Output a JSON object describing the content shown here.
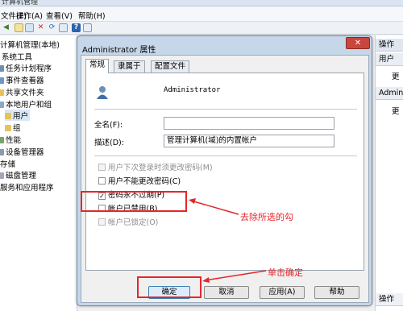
{
  "titlebar": {
    "text": "计算机管理"
  },
  "menubar": {
    "items": [
      "文件(F)",
      "操作(A)",
      "查看(V)",
      "帮助(H)"
    ]
  },
  "tree": {
    "items": [
      {
        "label": "计算机管理(本地)",
        "level": 0
      },
      {
        "label": "系统工具",
        "level": 1
      },
      {
        "label": "任务计划程序",
        "level": 2
      },
      {
        "label": "事件查看器",
        "level": 2
      },
      {
        "label": "共享文件夹",
        "level": 2
      },
      {
        "label": "本地用户和组",
        "level": 2
      },
      {
        "label": "用户",
        "level": 3
      },
      {
        "label": "组",
        "level": 3
      },
      {
        "label": "性能",
        "level": 2
      },
      {
        "label": "设备管理器",
        "level": 2
      },
      {
        "label": "存储",
        "level": 1
      },
      {
        "label": "磁盘管理",
        "level": 2
      },
      {
        "label": "服务和应用程序",
        "level": 1
      }
    ]
  },
  "actions": {
    "header1": "操作",
    "section1": "用户",
    "item1": "更",
    "section2": "Administrator",
    "item2": "更"
  },
  "dialog": {
    "title": "Administrator 属性",
    "close": "✕",
    "tabs": [
      "常规",
      "隶属于",
      "配置文件"
    ],
    "username": "Administrator",
    "fullname_label": "全名(F):",
    "fullname_value": "",
    "desc_label": "描述(D):",
    "desc_value": "管理计算机(域)的内置帐户",
    "checkboxes": [
      {
        "label": "用户下次登录时须更改密码(M)",
        "checked": false,
        "disabled": true
      },
      {
        "label": "用户不能更改密码(C)",
        "checked": false,
        "disabled": false
      },
      {
        "label": "密码永不过期(P)",
        "checked": true,
        "disabled": false
      },
      {
        "label": "帐户已禁用(B)",
        "checked": false,
        "disabled": false
      },
      {
        "label": "帐户已锁定(O)",
        "checked": false,
        "disabled": true
      }
    ],
    "buttons": {
      "ok": "确定",
      "cancel": "取消",
      "apply": "应用(A)",
      "help": "帮助"
    }
  },
  "annotations": {
    "uncheck_note": "去除所选的勾",
    "click_note": "单击确定"
  },
  "colors": {
    "annotation": "#e5262a",
    "dialog_frame": "#c6d7ea"
  }
}
